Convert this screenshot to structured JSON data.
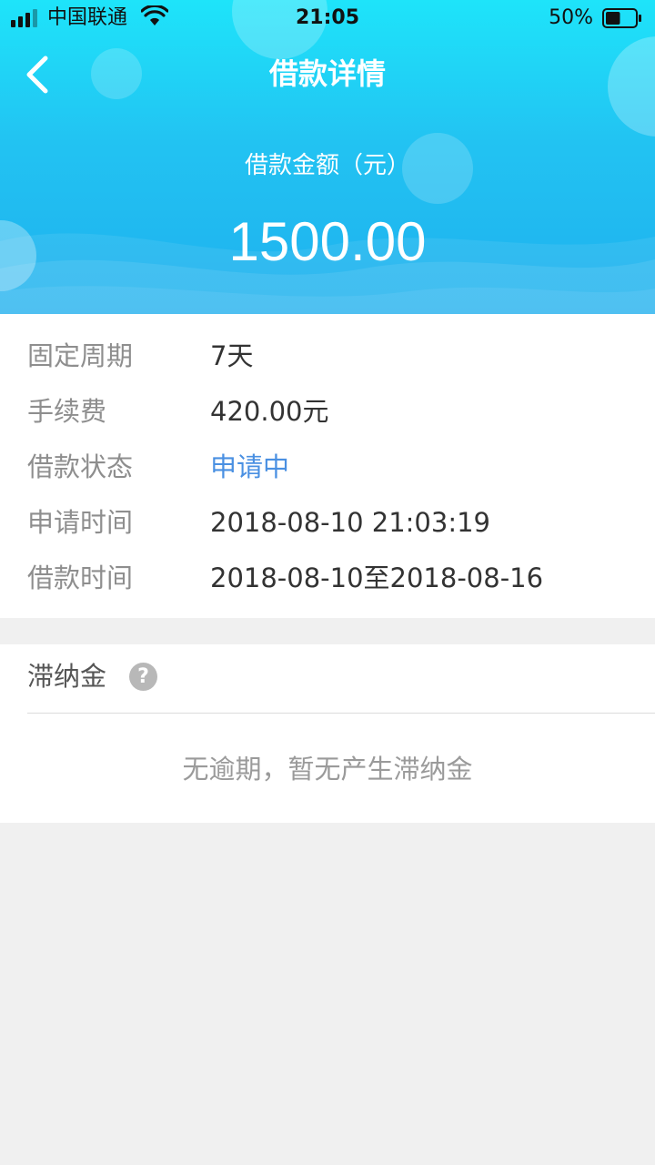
{
  "status_bar": {
    "carrier": "中国联通",
    "time": "21:05",
    "battery_percent": "50%",
    "battery_level": 0.5,
    "signal_icon": "signal-bars-icon",
    "wifi_icon": "wifi-icon",
    "battery_icon": "battery-icon"
  },
  "nav": {
    "title": "借款详情",
    "back_icon": "chevron-left-icon"
  },
  "summary": {
    "amount_label": "借款金额（元）",
    "amount_value": "1500.00"
  },
  "details": [
    {
      "label": "固定周期",
      "value": "7天"
    },
    {
      "label": "手续费",
      "value": "420.00元"
    },
    {
      "label": "借款状态",
      "value": "申请中"
    },
    {
      "label": "申请时间",
      "value": "2018-08-10 21:03:19"
    },
    {
      "label": "借款时间",
      "value": "2018-08-10至2018-08-16"
    }
  ],
  "late_fee": {
    "title": "滞纳金",
    "help_icon": "question-circle-icon",
    "help_glyph": "?",
    "empty_text": "无逾期，暂无产生滞纳金"
  },
  "colors": {
    "header_top": "#1ee4fa",
    "header_bottom": "#1fb0ee",
    "status_blue": "#4a90e2",
    "label_gray": "#8e8e8e",
    "value_dark": "#333333",
    "page_bg": "#f0f0f0"
  }
}
